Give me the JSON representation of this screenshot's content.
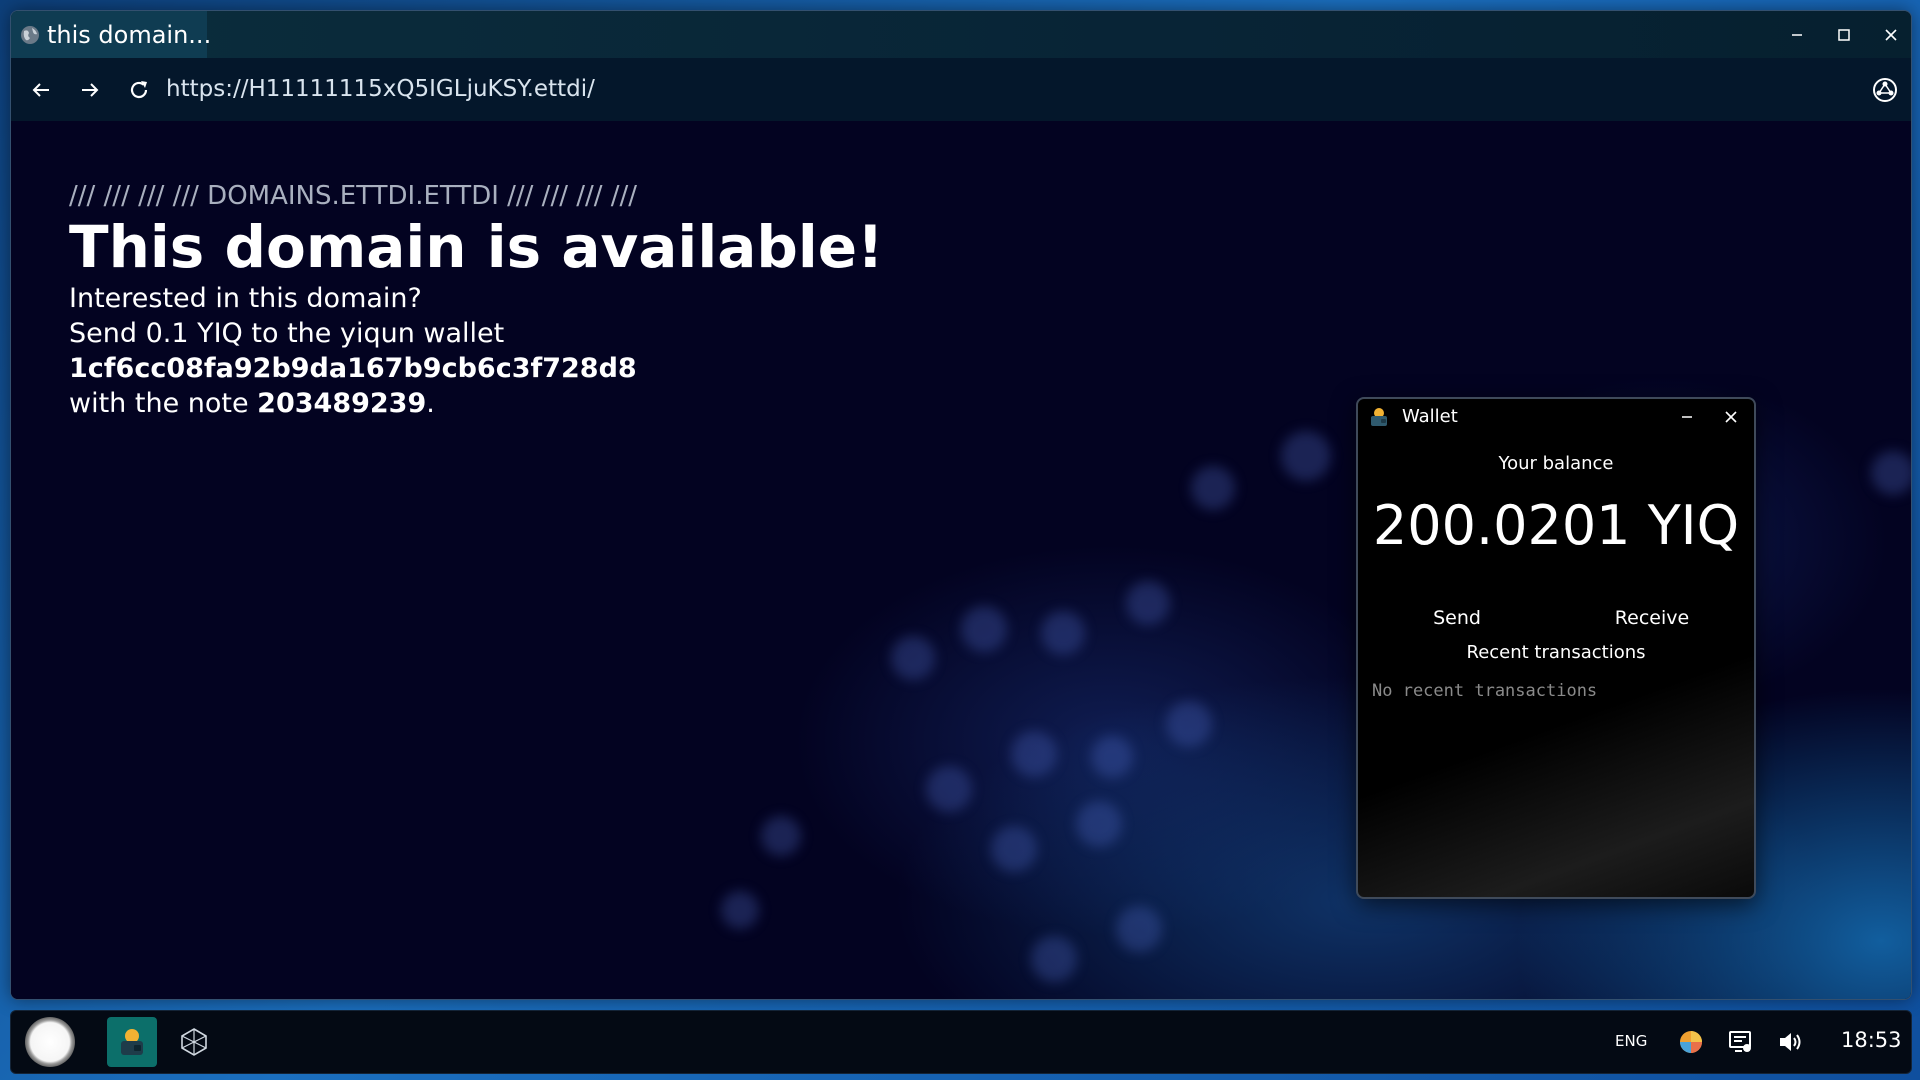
{
  "browser": {
    "tab_title": "this domain...",
    "url": "https://H11111115xQ5IGLjuKSY.ettdi/",
    "tab_icon": "globe-icon",
    "window_controls": [
      "minimize-icon",
      "maximize-icon",
      "close-icon"
    ],
    "nav_icons": [
      "back-arrow-icon",
      "forward-arrow-icon",
      "reload-icon"
    ],
    "extension_icon": "network-icon"
  },
  "page": {
    "eyebrow": "/// /// /// /// DOMAINS.ETTDI.ETTDI /// /// /// ///",
    "headline": "This domain is available!",
    "line1": "Interested in this domain?",
    "line2": "Send 0.1 YIQ to the yiqun wallet",
    "wallet_address": "1cf6cc08fa92b9da167b9cb6c3f728d8",
    "note_prefix": "with the note ",
    "note_value": "203489239",
    "note_suffix": "."
  },
  "wallet": {
    "title": "Wallet",
    "balance_label": "Your balance",
    "balance_value": "200.0201 YIQ",
    "send_label": "Send",
    "receive_label": "Receive",
    "recent_label": "Recent transactions",
    "no_transactions": "No recent transactions"
  },
  "taskbar": {
    "language": "ENG",
    "clock": "18:53",
    "apps": [
      "start-button",
      "wallet-app",
      "network-app"
    ],
    "tray_icons": [
      "color-wheel-icon",
      "display-settings-icon",
      "volume-icon"
    ]
  },
  "colors": {
    "page_background": "#030321",
    "wallet_background": "#000000",
    "taskbar_background": "#040a14",
    "desktop_accent": "#1b6fbf"
  }
}
